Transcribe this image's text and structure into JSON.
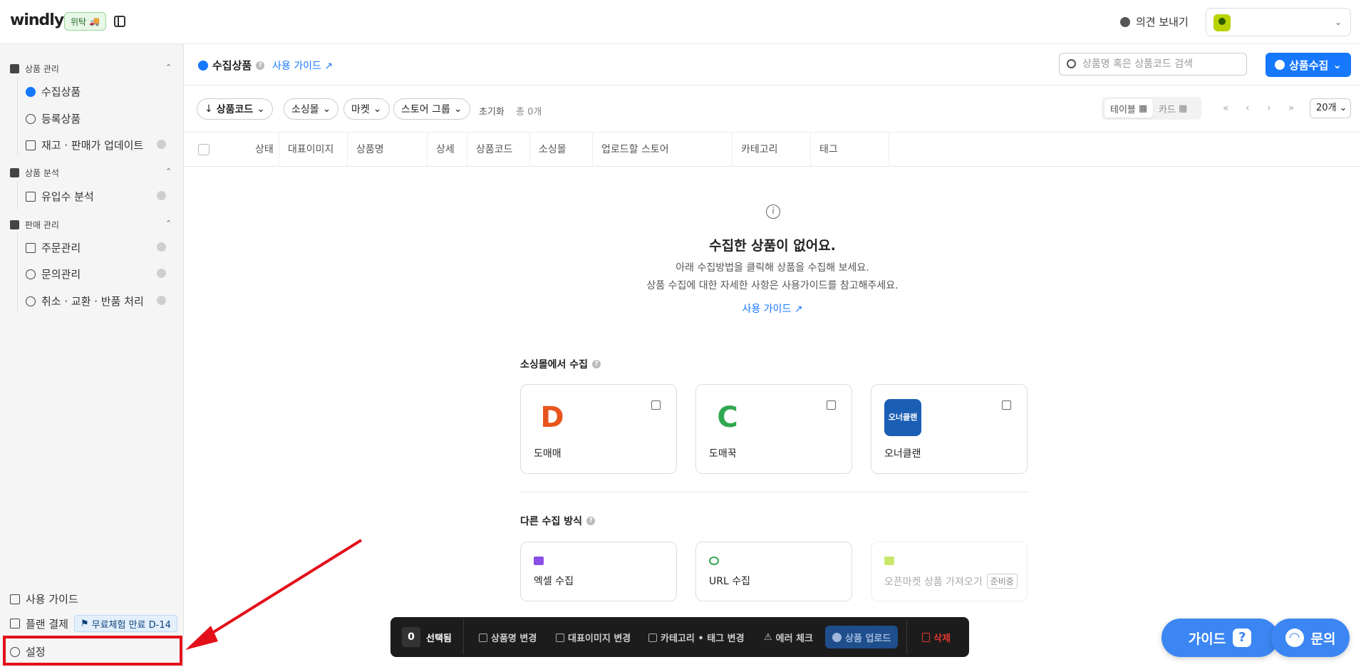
{
  "header": {
    "logo": "windly",
    "badge": "위탁",
    "feedback": "의견 보내기"
  },
  "sidebar": {
    "sections": [
      {
        "label": "상품 관리",
        "items": [
          "수집상품",
          "등록상품",
          "재고 · 판매가 업데이트"
        ]
      },
      {
        "label": "상품 분석",
        "items": [
          "유입수 분석"
        ]
      },
      {
        "label": "판매 관리",
        "items": [
          "주문관리",
          "문의관리",
          "취소 · 교환 · 반품 처리"
        ]
      }
    ],
    "bottom": {
      "guide": "사용 가이드",
      "plan": "플랜 결제",
      "trial": "무료체험 만료 D-14",
      "settings": "설정"
    }
  },
  "main": {
    "title": "수집상품",
    "guide_link": "사용 가이드",
    "search_placeholder": "상품명 혹은 상품코드 검색",
    "collect_button": "상품수집",
    "filters": {
      "product_code": "상품코드",
      "sourcing_mall": "소싱몰",
      "market": "마켓",
      "store_group": "스토어 그룹",
      "reset": "초기화",
      "total": "총 0개"
    },
    "view": {
      "table": "테이블",
      "card": "카드"
    },
    "per_page": "20개",
    "columns": [
      "상태",
      "대표이미지",
      "상품명",
      "상세",
      "상품코드",
      "소싱몰",
      "업로드할 스토어",
      "카테고리",
      "태그"
    ],
    "empty": {
      "title": "수집한 상품이 없어요.",
      "desc1": "아래 수집방법을 클릭해 상품을 수집해 보세요.",
      "desc2": "상품 수집에 대한 자세한 사항은 사용가이드를 참고해주세요.",
      "link": "사용 가이드"
    },
    "sourcing_group": {
      "title": "소싱몰에서 수집",
      "cards": [
        {
          "name": "도매매",
          "logo_text": "D",
          "logo_color": "#e8541d"
        },
        {
          "name": "도매꾹",
          "logo_text": "C",
          "logo_color": "#2fa84f"
        },
        {
          "name": "오너클랜",
          "logo_text": "오너클랜",
          "logo_color": "#1b5fb4"
        }
      ]
    },
    "other_group": {
      "title": "다른 수집 방식",
      "cards": [
        {
          "name": "엑셀 수집",
          "icon_color": "#8a4de8"
        },
        {
          "name": "URL 수집",
          "icon_color": "#2fa84f"
        },
        {
          "name": "오픈마켓 상품 가져오기",
          "tag": "준비중",
          "icon_color": "#c9e76a"
        }
      ]
    }
  },
  "action_bar": {
    "count": "0",
    "selected": "선택됨",
    "rename": "상품명 변경",
    "image": "대표이미지 변경",
    "category": "카테고리 • 태그 변경",
    "error": "에러 체크",
    "upload": "상품 업로드",
    "delete": "삭제"
  },
  "fabs": {
    "guide": "가이드",
    "inquiry": "문의"
  }
}
